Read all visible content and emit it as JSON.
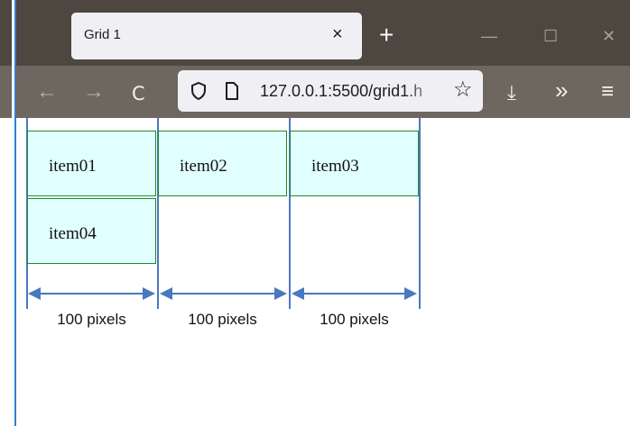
{
  "browser": {
    "tab": {
      "title": "Grid 1",
      "close": "×"
    },
    "new_tab": "+",
    "window": {
      "minimize": "—",
      "maximize": "☐",
      "close": "✕"
    },
    "nav": {
      "back": "←",
      "forward": "→",
      "reload": "C"
    },
    "url": "127.0.0.1:5500/grid1.h",
    "toolbar": {
      "bookmark": "☆",
      "download": "⤓",
      "overflow": "»",
      "menu": "≡"
    }
  },
  "grid": {
    "items": [
      "item01",
      "item02",
      "item03",
      "item04"
    ]
  },
  "annotations": {
    "column_widths": [
      "100 pixels",
      "100 pixels",
      "100 pixels"
    ]
  },
  "colors": {
    "cell_bg": "#e1ffff",
    "cell_border": "#1e8b2a",
    "guide_line": "#4a78c0"
  }
}
